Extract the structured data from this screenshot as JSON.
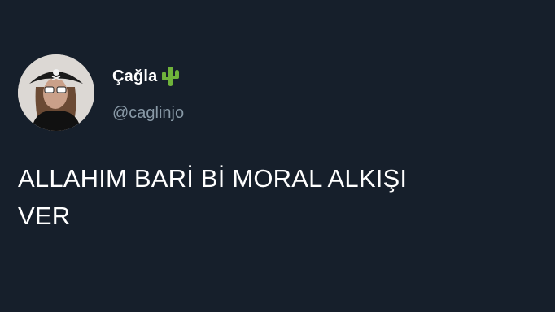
{
  "tweet": {
    "author": {
      "display_name": "Çağla",
      "emoji": "cactus-icon",
      "handle": "@caglinjo",
      "avatar": "profile-photo"
    },
    "text_line1": "ALLAHIM BARİ Bİ MORAL ALKIŞI",
    "text_line2": "VER"
  },
  "colors": {
    "background": "#161f2b",
    "text": "#ffffff",
    "handle": "#8899a6",
    "cactus": "#6fb33b"
  }
}
